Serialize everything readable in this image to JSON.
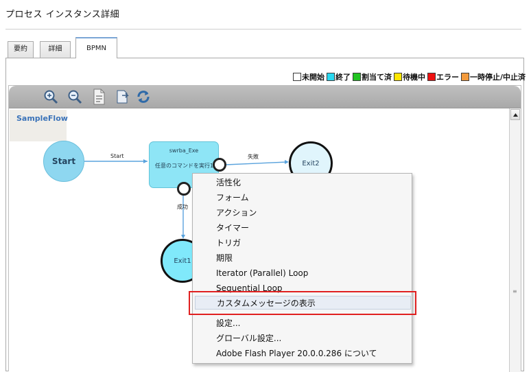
{
  "page": {
    "title": "プロセス インスタンス詳細"
  },
  "tabs": [
    {
      "label": "要約",
      "active": false
    },
    {
      "label": "詳細",
      "active": false
    },
    {
      "label": "BPMN",
      "active": true
    }
  ],
  "legend": [
    {
      "label": "未開始",
      "color": "#ffffff"
    },
    {
      "label": "終了",
      "color": "#2ad8f0"
    },
    {
      "label": "割当て済",
      "color": "#22c422"
    },
    {
      "label": "待機中",
      "color": "#ffe600"
    },
    {
      "label": "エラー",
      "color": "#ee1111"
    },
    {
      "label": "一時停止/中止済",
      "color": "#f39a3c"
    }
  ],
  "toolbar": {
    "buttons": [
      {
        "name": "zoom-in-icon"
      },
      {
        "name": "zoom-out-icon"
      },
      {
        "name": "document-icon"
      },
      {
        "name": "export-icon"
      },
      {
        "name": "refresh-icon"
      }
    ]
  },
  "diagram": {
    "flow_name": "SampleFlow",
    "start_label": "Start",
    "task_title": "swrba_Exe",
    "task_description": "任意のコマンドを実行1",
    "exit2_label": "Exit2",
    "exit1_label": "Exit1",
    "edge_start_label": "Start",
    "edge_fail_label": "失敗",
    "edge_success_label": "成功"
  },
  "context_menu": {
    "items": [
      "活性化",
      "フォーム",
      "アクション",
      "タイマー",
      "トリガ",
      "期限",
      "Iterator (Parallel) Loop",
      "Sequential Loop",
      "カスタムメッセージの表示"
    ],
    "highlighted_item": "カスタムメッセージの表示",
    "footer_items": [
      "設定...",
      "グローバル設定...",
      "Adobe Flash Player 20.0.0.286  について"
    ]
  },
  "colors": {
    "accent": "#3b73b9",
    "highlight_border": "#e02020"
  }
}
